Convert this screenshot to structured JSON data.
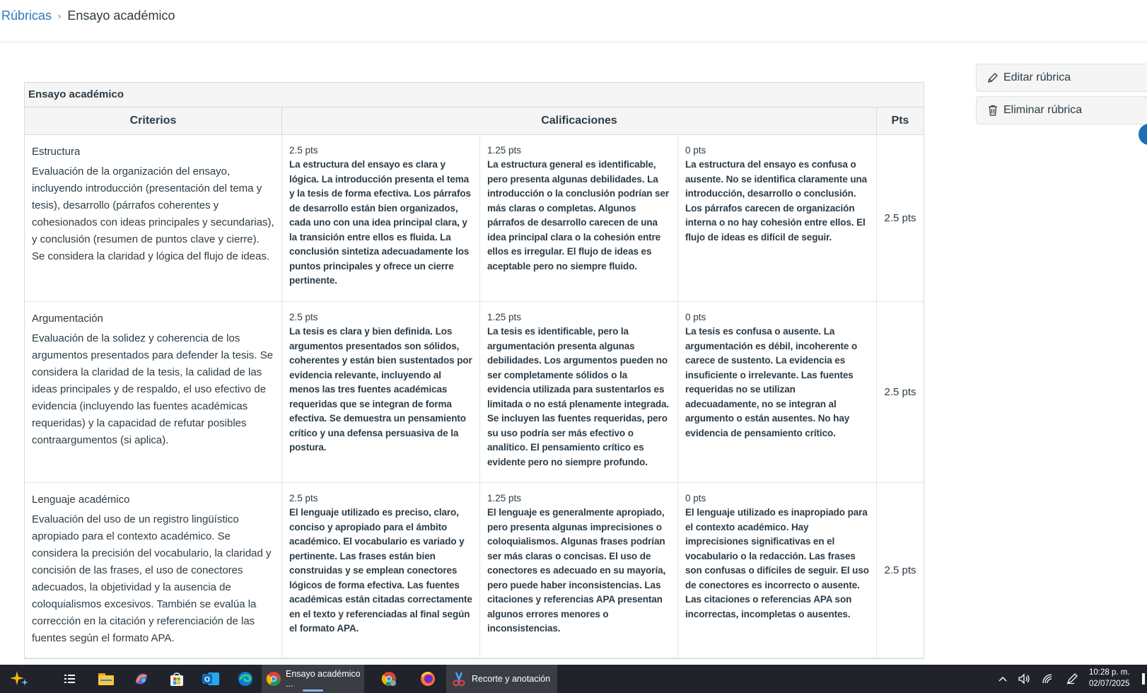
{
  "breadcrumb": {
    "link": "Rúbricas",
    "current": "Ensayo académico"
  },
  "actions": {
    "edit_label": "Editar rúbrica",
    "delete_label": "Eliminar rúbrica"
  },
  "rubric": {
    "title": "Ensayo académico",
    "headers": {
      "criteria": "Criterios",
      "ratings": "Calificaciones",
      "points": "Pts"
    },
    "criteria": [
      {
        "name": "Estructura",
        "description": "Evaluación de la organización del ensayo, incluyendo introducción (presentación del tema y tesis), desarrollo (párrafos coherentes y cohesionados con ideas principales y secundarias), y conclusión (resumen de puntos clave y cierre). Se considera la claridad y lógica del flujo de ideas.",
        "points": "2.5 pts",
        "ratings": [
          {
            "pts": "2.5 pts",
            "desc": "La estructura del ensayo es clara y lógica. La introducción presenta el tema y la tesis de forma efectiva. Los párrafos de desarrollo están bien organizados, cada uno con una idea principal clara, y la transición entre ellos es fluida. La conclusión sintetiza adecuadamente los puntos principales y ofrece un cierre pertinente."
          },
          {
            "pts": "1.25 pts",
            "desc": "La estructura general es identificable, pero presenta algunas debilidades. La introducción o la conclusión podrían ser más claras o completas. Algunos párrafos de desarrollo carecen de una idea principal clara o la cohesión entre ellos es irregular. El flujo de ideas es aceptable pero no siempre fluido."
          },
          {
            "pts": "0 pts",
            "desc": "La estructura del ensayo es confusa o ausente. No se identifica claramente una introducción, desarrollo o conclusión. Los párrafos carecen de organización interna o no hay cohesión entre ellos. El flujo de ideas es difícil de seguir."
          }
        ]
      },
      {
        "name": "Argumentación",
        "description": "Evaluación de la solidez y coherencia de los argumentos presentados para defender la tesis. Se considera la claridad de la tesis, la calidad de las ideas principales y de respaldo, el uso efectivo de evidencia (incluyendo las fuentes académicas requeridas) y la capacidad de refutar posibles contraargumentos (si aplica).",
        "points": "2.5 pts",
        "ratings": [
          {
            "pts": "2.5 pts",
            "desc": "La tesis es clara y bien definida. Los argumentos presentados son sólidos, coherentes y están bien sustentados por evidencia relevante, incluyendo al menos las tres fuentes académicas requeridas que se integran de forma efectiva. Se demuestra un pensamiento crítico y una defensa persuasiva de la postura."
          },
          {
            "pts": "1.25 pts",
            "desc": "La tesis es identificable, pero la argumentación presenta algunas debilidades. Los argumentos pueden no ser completamente sólidos o la evidencia utilizada para sustentarlos es limitada o no está plenamente integrada. Se incluyen las fuentes requeridas, pero su uso podría ser más efectivo o analítico. El pensamiento crítico es evidente pero no siempre profundo."
          },
          {
            "pts": "0 pts",
            "desc": "La tesis es confusa o ausente. La argumentación es débil, incoherente o carece de sustento. La evidencia es insuficiente o irrelevante. Las fuentes requeridas no se utilizan adecuadamente, no se integran al argumento o están ausentes. No hay evidencia de pensamiento crítico."
          }
        ]
      },
      {
        "name": "Lenguaje académico",
        "description": "Evaluación del uso de un registro lingüístico apropiado para el contexto académico. Se considera la precisión del vocabulario, la claridad y concisión de las frases, el uso de conectores adecuados, la objetividad y la ausencia de coloquialismos excesivos. También se evalúa la corrección en la citación y referenciación de las fuentes según el formato APA.",
        "points": "2.5 pts",
        "ratings": [
          {
            "pts": "2.5 pts",
            "desc": "El lenguaje utilizado es preciso, claro, conciso y apropiado para el ámbito académico. El vocabulario es variado y pertinente. Las frases están bien construidas y se emplean conectores lógicos de forma efectiva. Las fuentes académicas están citadas correctamente en el texto y referenciadas al final según el formato APA."
          },
          {
            "pts": "1.25 pts",
            "desc": "El lenguaje es generalmente apropiado, pero presenta algunas imprecisiones o coloquialismos. Algunas frases podrían ser más claras o concisas. El uso de conectores es adecuado en su mayoría, pero puede haber inconsistencias. Las citaciones y referencias APA presentan algunos errores menores o inconsistencias."
          },
          {
            "pts": "0 pts",
            "desc": "El lenguaje utilizado es inapropiado para el contexto académico. Hay imprecisiones significativas en el vocabulario o la redacción. Las frases son confusas o difíciles de seguir. El uso de conectores es incorrecto o ausente. Las citaciones o referencias APA son incorrectas, incompletas o ausentes."
          }
        ]
      }
    ]
  },
  "taskbar": {
    "apps": [
      {
        "icon": "copilot-sparkle-icon"
      },
      {
        "icon": "task-view-icon"
      },
      {
        "icon": "file-explorer-icon"
      },
      {
        "icon": "copilot-app-icon"
      },
      {
        "icon": "microsoft-store-icon"
      },
      {
        "icon": "outlook-icon"
      },
      {
        "icon": "edge-icon"
      },
      {
        "icon": "chrome-icon",
        "label": "Ensayo académico ..."
      },
      {
        "icon": "chrome-profile-icon"
      },
      {
        "icon": "firefox-icon"
      },
      {
        "icon": "snipping-tool-icon",
        "label": "Recorte y anotación"
      }
    ],
    "time": "10:28 p. m.",
    "date": "02/07/2025",
    "colors": {
      "background": "#20232a",
      "active": "#3a3d44"
    }
  },
  "colors": {
    "link": "#2b7abc",
    "header_bg": "#f5f5f5",
    "text": "#2d3b45"
  }
}
